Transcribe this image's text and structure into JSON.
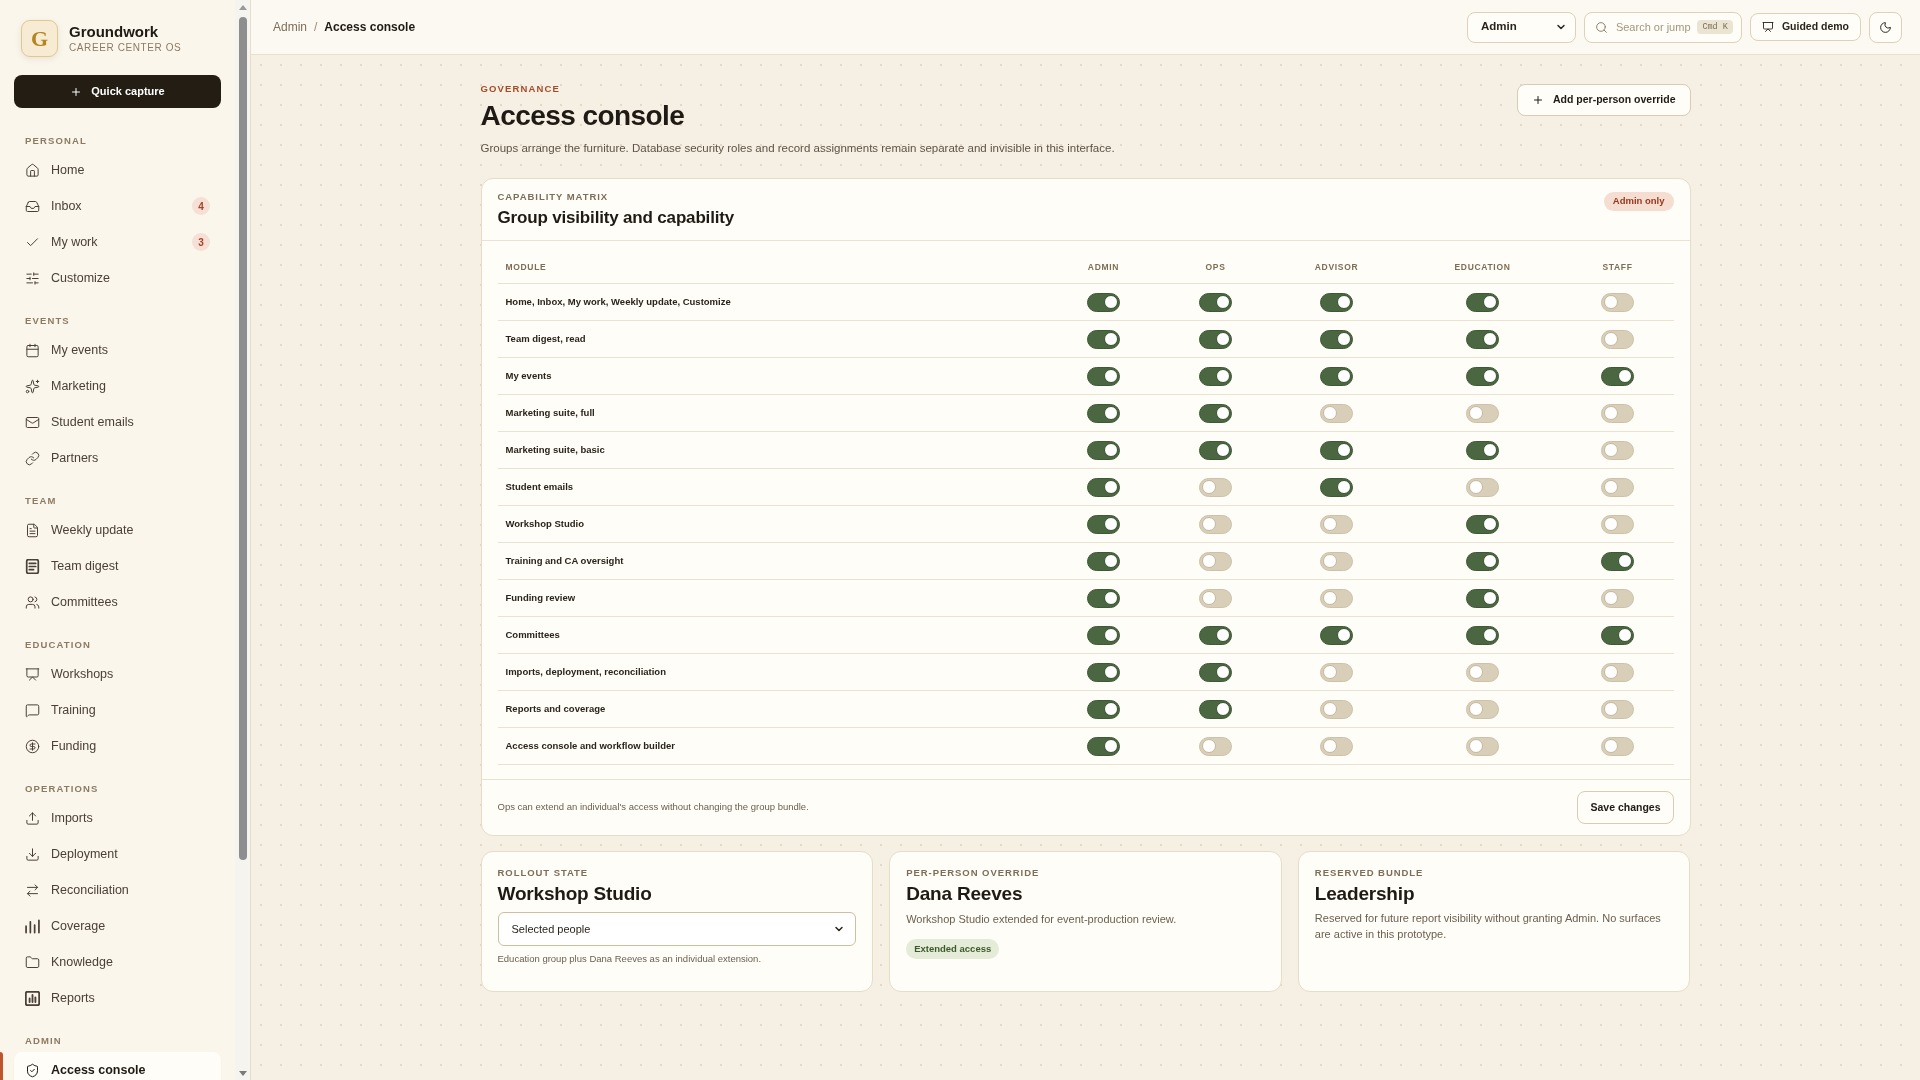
{
  "brand": {
    "logo_letter": "G",
    "name": "Groundwork",
    "tagline": "CAREER CENTER OS"
  },
  "quick_capture": {
    "label": "Quick capture"
  },
  "sidebar": {
    "sections": [
      {
        "label": "PERSONAL",
        "items": [
          {
            "label": "Home",
            "selected": false
          },
          {
            "label": "Inbox",
            "badge": "4",
            "selected": false
          },
          {
            "label": "My work",
            "badge": "3",
            "selected": false
          },
          {
            "label": "Customize",
            "selected": false
          }
        ]
      },
      {
        "label": "EVENTS",
        "items": [
          {
            "label": "My events",
            "selected": false
          },
          {
            "label": "Marketing",
            "selected": false
          },
          {
            "label": "Student emails",
            "selected": false
          },
          {
            "label": "Partners",
            "selected": false
          }
        ]
      },
      {
        "label": "TEAM",
        "items": [
          {
            "label": "Weekly update",
            "selected": false
          },
          {
            "label": "Team digest",
            "selected": false
          },
          {
            "label": "Committees",
            "selected": false
          }
        ]
      },
      {
        "label": "EDUCATION",
        "items": [
          {
            "label": "Workshops",
            "selected": false
          },
          {
            "label": "Training",
            "selected": false
          },
          {
            "label": "Funding",
            "selected": false
          }
        ]
      },
      {
        "label": "OPERATIONS",
        "items": [
          {
            "label": "Imports",
            "selected": false
          },
          {
            "label": "Deployment",
            "selected": false
          },
          {
            "label": "Reconciliation",
            "selected": false
          },
          {
            "label": "Coverage",
            "selected": false
          },
          {
            "label": "Knowledge",
            "selected": false
          },
          {
            "label": "Reports",
            "selected": false
          }
        ]
      },
      {
        "label": "ADMIN",
        "items": [
          {
            "label": "Access console",
            "selected": true
          }
        ]
      }
    ]
  },
  "topbar": {
    "breadcrumb": [
      {
        "label": "Admin"
      },
      {
        "label": "Access console"
      }
    ],
    "breadcrumb_separator": "/",
    "role_select": {
      "value": "Admin"
    },
    "search": {
      "placeholder": "Search or jump",
      "shortcut": "Cmd K"
    },
    "guided_demo": {
      "label": "Guided demo"
    }
  },
  "page": {
    "eyebrow": "GOVERNANCE",
    "title": "Access console",
    "description": "Groups arrange the furniture. Database security roles and record assignments remain separate and invisible in this interface.",
    "action": {
      "label": "Add per-person override"
    }
  },
  "matrix": {
    "eyebrow": "CAPABILITY MATRIX",
    "title": "Group visibility and capability",
    "badge": "Admin only",
    "columns": [
      "MODULE",
      "ADMIN",
      "OPS",
      "ADVISOR",
      "EDUCATION",
      "STAFF"
    ],
    "rows": [
      {
        "module": "Home, Inbox, My work, Weekly update, Customize",
        "cells": [
          {
            "on": true
          },
          {
            "on": true
          },
          {
            "on": true
          },
          {
            "on": true
          },
          {
            "on": false
          }
        ]
      },
      {
        "module": "Team digest, read",
        "cells": [
          {
            "on": true
          },
          {
            "on": true
          },
          {
            "on": true
          },
          {
            "on": true
          },
          {
            "on": false
          }
        ]
      },
      {
        "module": "My events",
        "cells": [
          {
            "on": true
          },
          {
            "on": true
          },
          {
            "on": true
          },
          {
            "on": true
          },
          {
            "on": true
          }
        ]
      },
      {
        "module": "Marketing suite, full",
        "cells": [
          {
            "on": true
          },
          {
            "on": true
          },
          {
            "on": false
          },
          {
            "on": false
          },
          {
            "on": false
          }
        ]
      },
      {
        "module": "Marketing suite, basic",
        "cells": [
          {
            "on": true
          },
          {
            "on": true
          },
          {
            "on": true
          },
          {
            "on": true
          },
          {
            "on": false
          }
        ]
      },
      {
        "module": "Student emails",
        "cells": [
          {
            "on": true
          },
          {
            "on": false
          },
          {
            "on": true
          },
          {
            "on": false
          },
          {
            "on": false
          }
        ]
      },
      {
        "module": "Workshop Studio",
        "cells": [
          {
            "on": true
          },
          {
            "on": false
          },
          {
            "on": false
          },
          {
            "on": true
          },
          {
            "on": false
          }
        ]
      },
      {
        "module": "Training and CA oversight",
        "cells": [
          {
            "on": true
          },
          {
            "on": false
          },
          {
            "on": false
          },
          {
            "on": true
          },
          {
            "on": true
          }
        ]
      },
      {
        "module": "Funding review",
        "cells": [
          {
            "on": true
          },
          {
            "on": false
          },
          {
            "on": false
          },
          {
            "on": true
          },
          {
            "on": false
          }
        ]
      },
      {
        "module": "Committees",
        "cells": [
          {
            "on": true
          },
          {
            "on": true
          },
          {
            "on": true
          },
          {
            "on": true
          },
          {
            "on": true
          }
        ]
      },
      {
        "module": "Imports, deployment, reconciliation",
        "cells": [
          {
            "on": true
          },
          {
            "on": true
          },
          {
            "on": false
          },
          {
            "on": false
          },
          {
            "on": false
          }
        ]
      },
      {
        "module": "Reports and coverage",
        "cells": [
          {
            "on": true
          },
          {
            "on": true
          },
          {
            "on": false
          },
          {
            "on": false
          },
          {
            "on": false
          }
        ]
      },
      {
        "module": "Access console and workflow builder",
        "cells": [
          {
            "on": true
          },
          {
            "on": false
          },
          {
            "on": false
          },
          {
            "on": false
          },
          {
            "on": false
          }
        ]
      }
    ],
    "footer_note": "Ops can extend an individual's access without changing the group bundle.",
    "save_button": {
      "label": "Save changes"
    }
  },
  "cards": [
    {
      "kind": "select",
      "eyebrow": "ROLLOUT STATE",
      "title": "Workshop Studio",
      "select_value": "Selected people",
      "note": "Education group plus Dana Reeves as an individual extension."
    },
    {
      "kind": "override",
      "eyebrow": "PER-PERSON OVERRIDE",
      "title": "Dana Reeves",
      "description": "Workshop Studio extended for event-production review.",
      "badge": "Extended access"
    },
    {
      "kind": "text",
      "eyebrow": "RESERVED BUNDLE",
      "title": "Leadership",
      "description": "Reserved for future report visibility without granting Admin. No surfaces are active in this prototype."
    }
  ]
}
